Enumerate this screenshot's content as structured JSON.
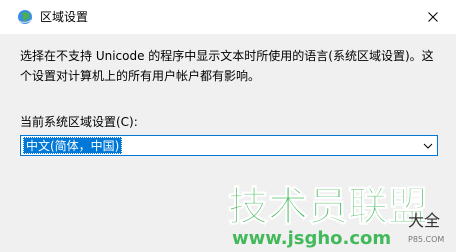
{
  "window": {
    "title": "区域设置"
  },
  "dialog": {
    "description": "选择在不支持 Unicode 的程序中显示文本时所使用的语言(系统区域设置)。这个设置对计算机上的所有用户帐户都有影响。",
    "select_label": "当前系统区域设置(C):",
    "select_value": "中文(简体，中国)"
  },
  "watermark": {
    "brand": "技术员联盟",
    "url": "www.jsgho.com",
    "extra": "大全",
    "extra2": "P85.COM"
  },
  "colors": {
    "accent": "#0078d7",
    "content_bg": "#f0f0f0",
    "watermark_green": "#2fb24a"
  }
}
